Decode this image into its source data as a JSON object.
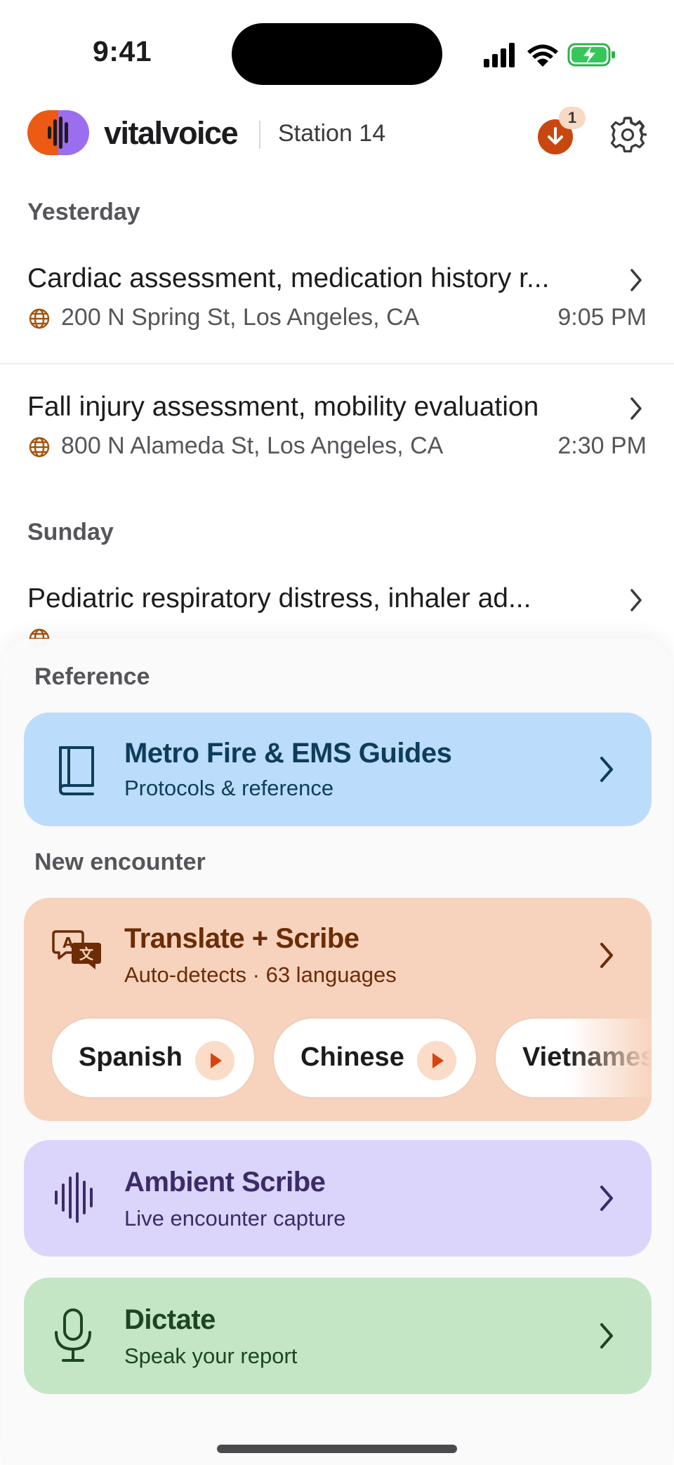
{
  "status_bar": {
    "time": "9:41"
  },
  "header": {
    "brand": "vitalvoice",
    "station": "Station 14",
    "download_badge_count": "1"
  },
  "history": {
    "groups": [
      {
        "label": "Yesterday",
        "items": [
          {
            "title": "Cardiac assessment, medication history r...",
            "address": "200 N Spring St, Los Angeles, CA",
            "time": "9:05 PM"
          },
          {
            "title": "Fall injury assessment, mobility evaluation",
            "address": "800 N Alameda St, Los Angeles, CA",
            "time": "2:30 PM"
          }
        ]
      },
      {
        "label": "Sunday",
        "items": [
          {
            "title": "Pediatric respiratory distress, inhaler ad..."
          }
        ]
      }
    ]
  },
  "sheet": {
    "reference_label": "Reference",
    "reference_card": {
      "title": "Metro Fire & EMS Guides",
      "subtitle": "Protocols & reference"
    },
    "new_encounter_label": "New encounter",
    "translate_card": {
      "title": "Translate + Scribe",
      "subtitle": "Auto-detects · 63 languages",
      "languages": [
        "Spanish",
        "Chinese",
        "Vietnamese"
      ]
    },
    "ambient_card": {
      "title": "Ambient Scribe",
      "subtitle": "Live encounter capture"
    },
    "dictate_card": {
      "title": "Dictate",
      "subtitle": "Speak your report"
    }
  },
  "colors": {
    "accent_orange": "#c8470e",
    "reference_bg": "#bcdcfb",
    "translate_bg": "#f7d3bd",
    "ambient_bg": "#dcd5fb",
    "dictate_bg": "#c4e6c5"
  },
  "icons": {
    "reference": "book-icon",
    "translate": "translate-icon",
    "ambient": "waveform-icon",
    "dictate": "microphone-icon",
    "location": "globe-icon",
    "settings": "gear-icon",
    "download": "download-icon"
  }
}
